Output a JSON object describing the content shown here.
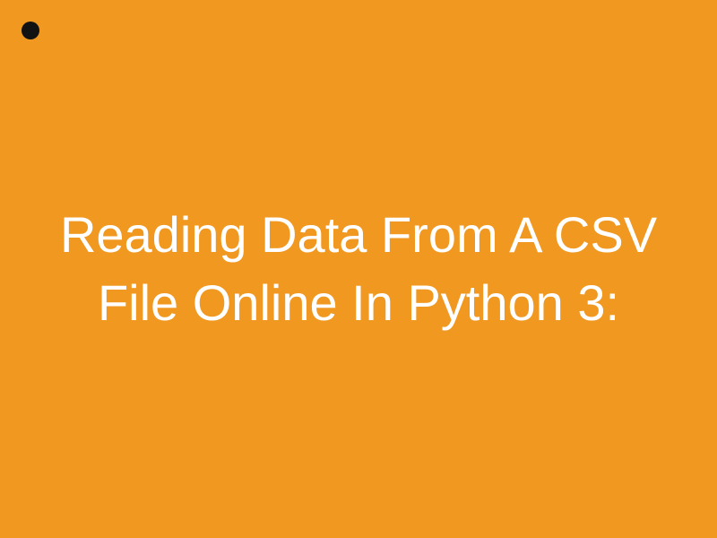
{
  "title": "Reading Data From A CSV File Online In Python 3:",
  "colors": {
    "background": "#f09820",
    "text": "#ffffff",
    "bullet": "#121212"
  }
}
